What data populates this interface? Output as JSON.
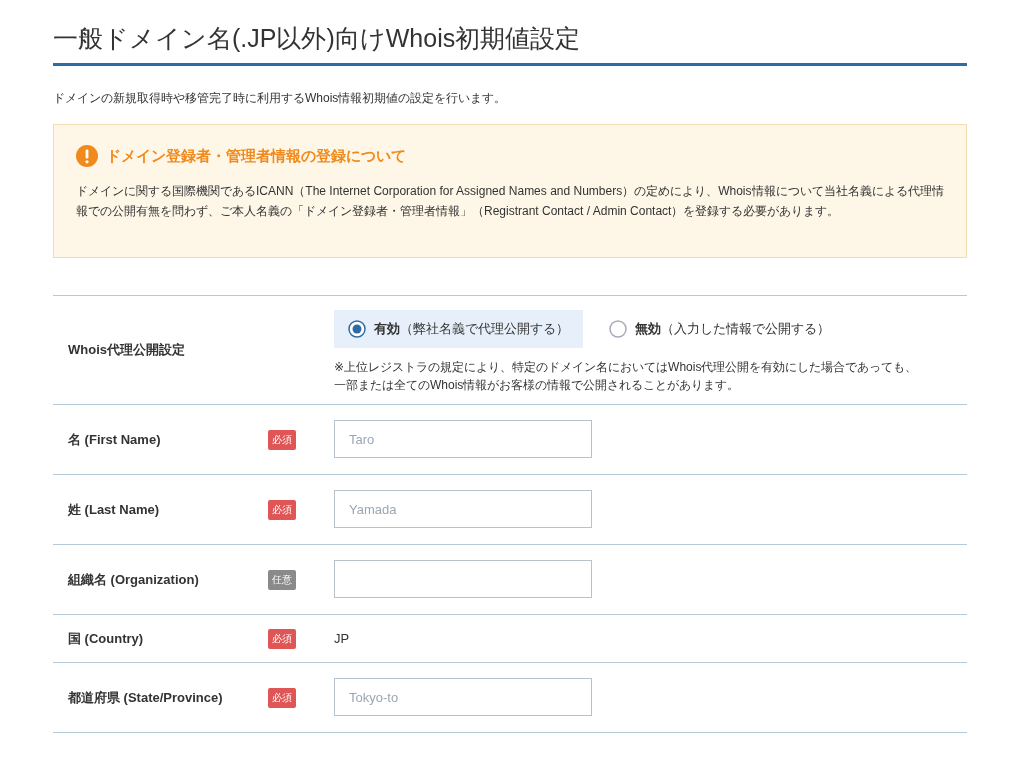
{
  "page_title": "一般ドメイン名(.JP以外)向けWhois初期値設定",
  "description": "ドメインの新規取得時や移管完了時に利用するWhois情報初期値の設定を行います。",
  "notice": {
    "title": "ドメイン登録者・管理者情報の登録について",
    "body": "ドメインに関する国際機関であるICANN（The Internet Corporation for Assigned Names and Numbers）の定めにより、Whois情報について当社名義による代理情報での公開有無を問わず、ご本人名義の「ドメイン登録者・管理者情報」（Registrant Contact / Admin Contact）を登録する必要があります。"
  },
  "form_rows": [
    {
      "kind": "radio",
      "label": "Whois代理公開設定",
      "options": [
        {
          "label": "有効",
          "detail": "（弊社名義で代理公開する）",
          "selected": true
        },
        {
          "label": "無効",
          "detail": "（入力した情報で公開する）",
          "selected": false
        }
      ],
      "note_lines": [
        "※上位レジストラの規定により、特定のドメイン名においてはWhois代理公開を有効にした場合であっても、",
        "一部または全てのWhois情報がお客様の情報で公開されることがあります。"
      ]
    },
    {
      "kind": "input",
      "label": "名 (First Name)",
      "badge": "必須",
      "required": true,
      "placeholder": "Taro"
    },
    {
      "kind": "input",
      "label": "姓 (Last Name)",
      "badge": "必須",
      "required": true,
      "placeholder": "Yamada"
    },
    {
      "kind": "input",
      "label": "組織名 (Organization)",
      "badge": "任意",
      "required": false
    },
    {
      "kind": "text",
      "label": "国 (Country)",
      "badge": "必須",
      "required": true,
      "value": "JP"
    },
    {
      "kind": "input",
      "label": "都道府県 (State/Province)",
      "badge": "必須",
      "required": true,
      "placeholder": "Tokyo-to"
    }
  ]
}
